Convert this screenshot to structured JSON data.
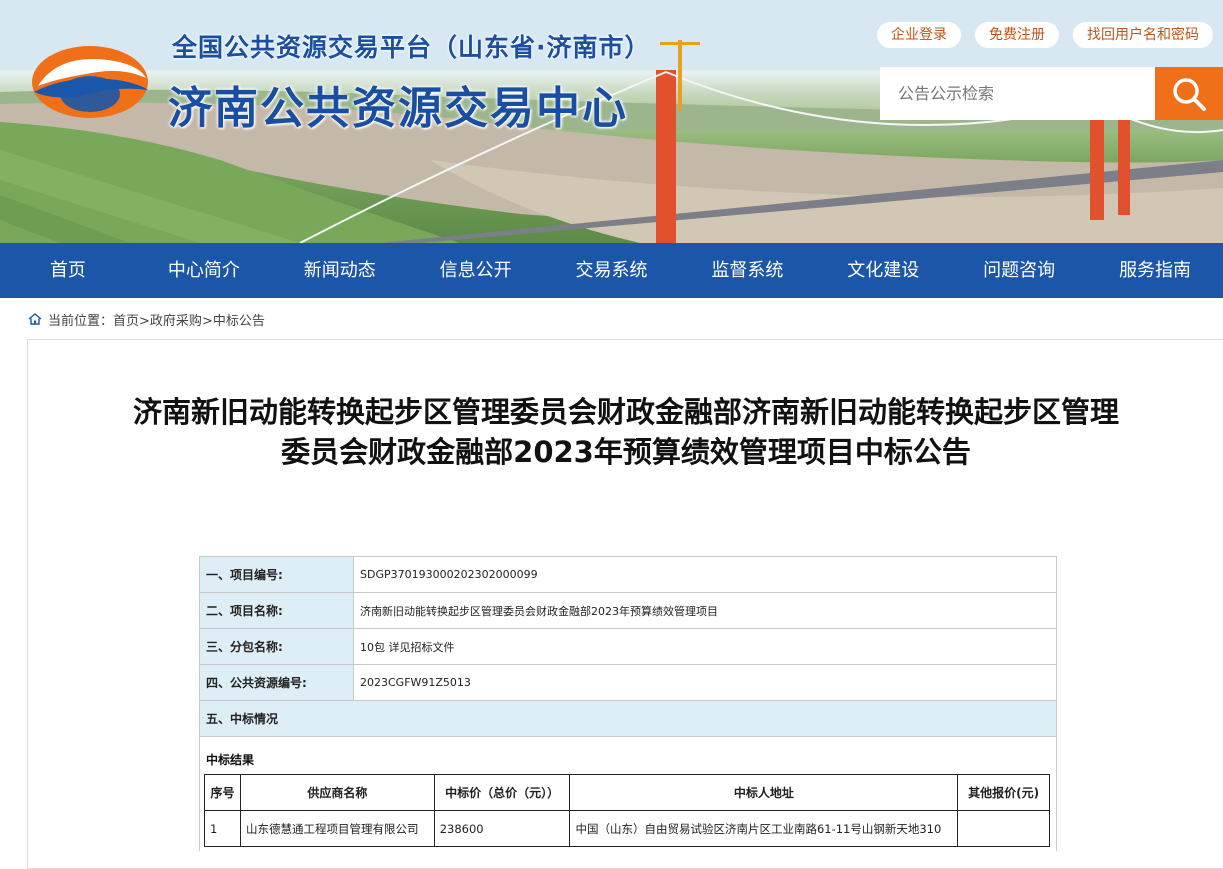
{
  "header": {
    "site_subtitle": "全国公共资源交易平台（山东省·济南市）",
    "site_title": "济南公共资源交易中心",
    "top_links": [
      "企业登录",
      "免费注册",
      "找回用户名和密码"
    ],
    "search": {
      "placeholder": "公告公示检索"
    }
  },
  "nav": {
    "items": [
      "首页",
      "中心简介",
      "新闻动态",
      "信息公开",
      "交易系统",
      "监督系统",
      "文化建设",
      "问题咨询",
      "服务指南"
    ]
  },
  "breadcrumb": {
    "prefix": "当前位置：",
    "items": [
      "首页",
      " >政府采购",
      ">中标公告"
    ]
  },
  "article": {
    "title_line1": "济南新旧动能转换起步区管理委员会财政金融部济南新旧动能转换起步区管理",
    "title_line2": "委员会财政金融部2023年预算绩效管理项目中标公告",
    "fields": [
      {
        "label": "一、项目编号:",
        "value": "SDGP370193000202302000099"
      },
      {
        "label": "二、项目名称:",
        "value": "济南新旧动能转换起步区管理委员会财政金融部2023年预算绩效管理项目"
      },
      {
        "label": "三、分包名称:",
        "value": "10包 详见招标文件"
      },
      {
        "label": "四、公共资源编号:",
        "value": "2023CGFW91Z5013"
      }
    ],
    "section5": "五、中标情况",
    "result_caption": "中标结果",
    "result_headers": [
      "序号",
      "供应商名称",
      "中标价（总价（元））",
      "中标人地址",
      "其他报价(元)"
    ],
    "result_rows": [
      [
        "1",
        "山东德慧通工程项目管理有限公司",
        "238600",
        "中国（山东）自由贸易试验区济南片区工业南路61-11号山钢新天地310",
        ""
      ]
    ]
  },
  "colors": {
    "nav_bg": "#1b56a9",
    "search_button": "#f07019",
    "label_bg": "#deeef7",
    "title_blue": "#1a4ea3"
  }
}
